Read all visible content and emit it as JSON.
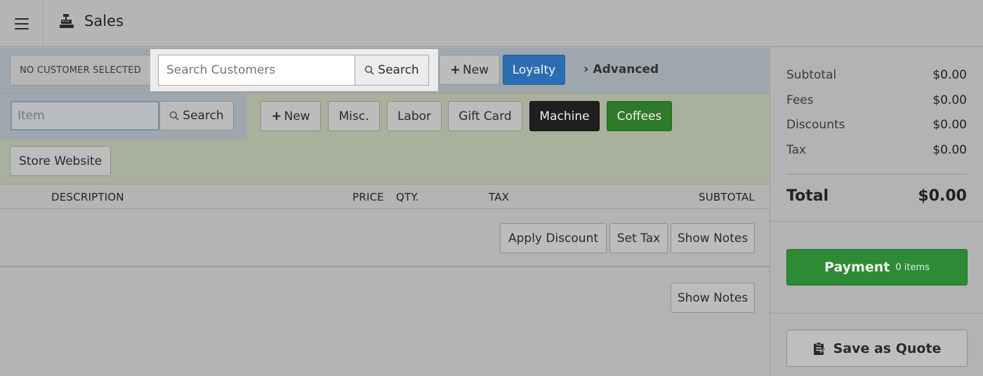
{
  "header": {
    "title": "Sales"
  },
  "customer": {
    "none_selected": "NO CUSTOMER SELECTED",
    "search_placeholder": "Search Customers",
    "search_label": "Search",
    "new_label": "New",
    "loyalty_label": "Loyalty",
    "advanced_label": "Advanced"
  },
  "items": {
    "search_placeholder": "Item",
    "search_label": "Search",
    "quick_buttons": {
      "new": "New",
      "misc": "Misc.",
      "labor": "Labor",
      "gift_card": "Gift Card",
      "machine": "Machine",
      "coffees": "Coffees",
      "store_website": "Store Website"
    }
  },
  "table": {
    "columns": {
      "description": "DESCRIPTION",
      "price": "PRICE",
      "qty": "QTY.",
      "tax": "TAX",
      "subtotal": "SUBTOTAL"
    },
    "actions": {
      "apply_discount": "Apply Discount",
      "set_tax": "Set Tax",
      "show_notes": "Show Notes",
      "show_notes_2": "Show Notes"
    }
  },
  "summary": {
    "subtotal_label": "Subtotal",
    "subtotal": "$0.00",
    "fees_label": "Fees",
    "fees": "$0.00",
    "discounts_label": "Discounts",
    "discounts": "$0.00",
    "tax_label": "Tax",
    "tax": "$0.00",
    "total_label": "Total",
    "total": "$0.00"
  },
  "payment": {
    "label": "Payment",
    "count": "0 items"
  },
  "quote": {
    "label": "Save as Quote"
  },
  "colors": {
    "loyalty": "#2b6db0",
    "machine": "#1f1f1f",
    "coffees": "#2e7a2b",
    "payment": "#2d8a35"
  }
}
